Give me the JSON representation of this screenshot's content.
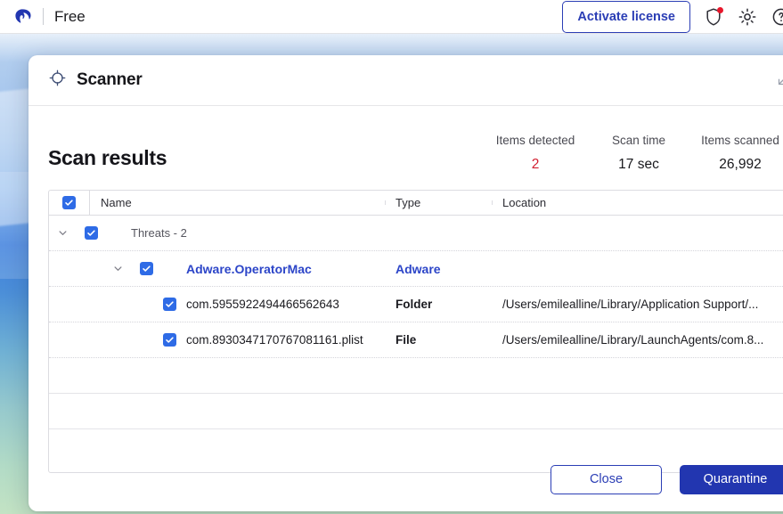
{
  "app_header": {
    "logo_icon": "malwarebytes-logo",
    "edition": "Free",
    "activate_label": "Activate license",
    "icons": [
      {
        "name": "shield-icon",
        "has_notification": true
      },
      {
        "name": "gear-icon",
        "has_notification": false
      },
      {
        "name": "help-icon",
        "has_notification": false
      }
    ]
  },
  "dialog": {
    "icon": "crosshair-icon",
    "title": "Scanner",
    "minimize_icon": "collapse-arrow-icon",
    "results_title": "Scan results",
    "stats": [
      {
        "label": "Items detected",
        "value": "2",
        "alert": true
      },
      {
        "label": "Scan time",
        "value": "17 sec",
        "alert": false
      },
      {
        "label": "Items scanned",
        "value": "26,992",
        "alert": false
      }
    ],
    "table": {
      "columns": [
        "Name",
        "Type",
        "Location"
      ],
      "select_all_checked": true,
      "group": {
        "label": "Threats - 2",
        "checked": true,
        "expanded": true
      },
      "threat": {
        "name": "Adware.OperatorMac",
        "type": "Adware",
        "location": "",
        "checked": true,
        "expanded": true
      },
      "items": [
        {
          "name": "com.5955922494466562643",
          "type": "Folder",
          "location": "/Users/emilealline/Library/Application Support/...",
          "checked": true
        },
        {
          "name": "com.8930347170767081161.plist",
          "type": "File",
          "location": "/Users/emilealline/Library/LaunchAgents/com.8...",
          "checked": true
        }
      ],
      "empty_row_count": 3
    },
    "footer": {
      "close_label": "Close",
      "quarantine_label": "Quarantine"
    }
  },
  "colors": {
    "brand_blue": "#2236B0",
    "link_blue": "#2C45C8",
    "checkbox_blue": "#2E6BE6",
    "alert_red": "#D22030"
  }
}
